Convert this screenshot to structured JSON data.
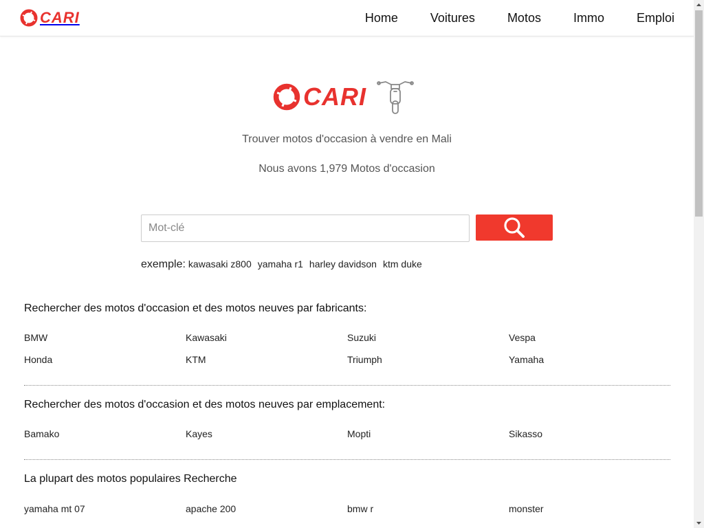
{
  "brand": {
    "name": "CARI",
    "color": "#e8322e"
  },
  "nav": {
    "items": [
      {
        "label": "Home"
      },
      {
        "label": "Voitures"
      },
      {
        "label": "Motos"
      },
      {
        "label": "Immo"
      },
      {
        "label": "Emploi"
      }
    ]
  },
  "hero": {
    "brand_name": "CARI",
    "icon": "motorcycle-icon",
    "tagline": "Trouver motos d'occasion à vendre en Mali",
    "count_text": "Nous avons 1,979 Motos d'occasion"
  },
  "search": {
    "placeholder": "Mot-clé",
    "value": "",
    "button_icon": "search-icon",
    "button_color": "#f0392d"
  },
  "examples": {
    "label": "exemple:",
    "items": [
      "kawasaki z800",
      "yamaha r1",
      "harley davidson",
      "ktm duke"
    ]
  },
  "sections": {
    "manufacturers": {
      "title": "Rechercher des motos d'occasion et des motos neuves par fabricants:",
      "rows": [
        [
          "BMW",
          "Kawasaki",
          "Suzuki",
          "Vespa"
        ],
        [
          "Honda",
          "KTM",
          "Triumph",
          "Yamaha"
        ]
      ]
    },
    "locations": {
      "title": "Rechercher des motos d'occasion et des motos neuves par emplacement:",
      "rows": [
        [
          "Bamako",
          "Kayes",
          "Mopti",
          "Sikasso"
        ]
      ]
    },
    "popular": {
      "title": "La plupart des motos populaires Recherche",
      "rows": [
        [
          "yamaha mt 07",
          "apache 200",
          "bmw r",
          "monster"
        ]
      ]
    }
  }
}
